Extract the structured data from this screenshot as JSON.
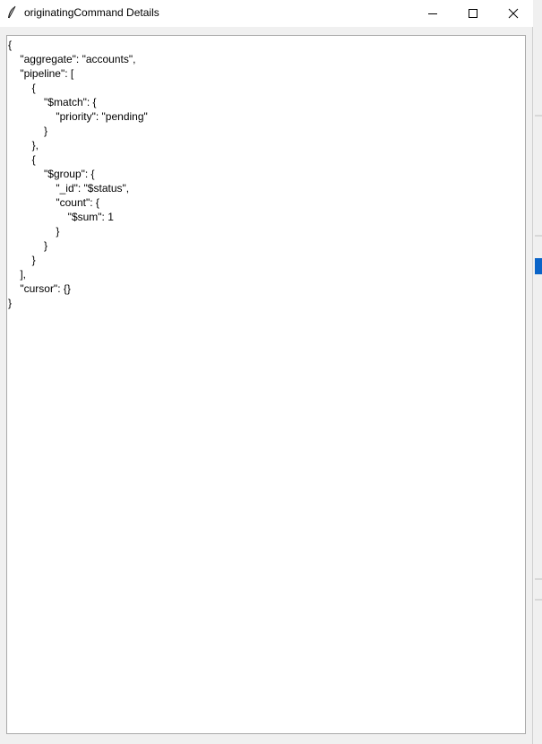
{
  "window": {
    "title": "originatingCommand Details"
  },
  "icons": {
    "app": "feather-icon",
    "minimize": "minimize-icon",
    "maximize": "maximize-icon",
    "close": "close-icon"
  },
  "colors": {
    "background_accent": "#0a64c8"
  },
  "editor": {
    "lines": [
      "{",
      "    \"aggregate\": \"accounts\",",
      "    \"pipeline\": [",
      "        {",
      "            \"$match\": {",
      "                \"priority\": \"pending\"",
      "            }",
      "        },",
      "        {",
      "            \"$group\": {",
      "                \"_id\": \"$status\",",
      "                \"count\": {",
      "                    \"$sum\": 1",
      "                }",
      "            }",
      "        }",
      "    ],",
      "    \"cursor\": {}",
      "}"
    ]
  }
}
